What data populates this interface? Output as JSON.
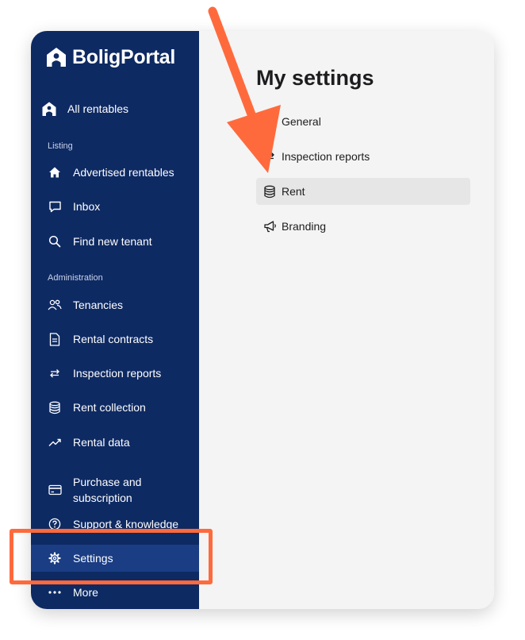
{
  "brand": {
    "name": "BoligPortal"
  },
  "sidebar": {
    "top_item": {
      "label": "All rentables",
      "icon": "home-person-icon"
    },
    "sections": [
      {
        "title": "Listing",
        "items": [
          {
            "label": "Advertised rentables",
            "icon": "house-icon"
          },
          {
            "label": "Inbox",
            "icon": "chat-bubble-icon"
          },
          {
            "label": "Find new tenant",
            "icon": "search-icon"
          }
        ]
      },
      {
        "title": "Administration",
        "items": [
          {
            "label": "Tenancies",
            "icon": "people-icon"
          },
          {
            "label": "Rental contracts",
            "icon": "document-icon"
          },
          {
            "label": "Inspection reports",
            "icon": "swap-arrows-icon"
          },
          {
            "label": "Rent collection",
            "icon": "database-icon"
          },
          {
            "label": "Rental data",
            "icon": "trend-icon"
          }
        ]
      }
    ],
    "bottom_items": [
      {
        "label": "Purchase and subscription",
        "icon": "credit-card-icon"
      },
      {
        "label": "Support & knowledge",
        "icon": "help-circle-icon"
      },
      {
        "label": "Settings",
        "icon": "gear-icon",
        "active": true
      },
      {
        "label": "More",
        "icon": "more-dots-icon"
      }
    ]
  },
  "main": {
    "title": "My settings",
    "items": [
      {
        "label": "General",
        "icon": "arrow-icon"
      },
      {
        "label": "Inspection reports",
        "icon": "swap-arrows-icon"
      },
      {
        "label": "Rent",
        "icon": "database-icon",
        "active": true
      },
      {
        "label": "Branding",
        "icon": "megaphone-icon"
      }
    ]
  },
  "colors": {
    "sidebar_bg": "#0e2a63",
    "sidebar_active": "#1a3d84",
    "callout": "#ff6a3d",
    "main_bg": "#f4f4f4"
  }
}
